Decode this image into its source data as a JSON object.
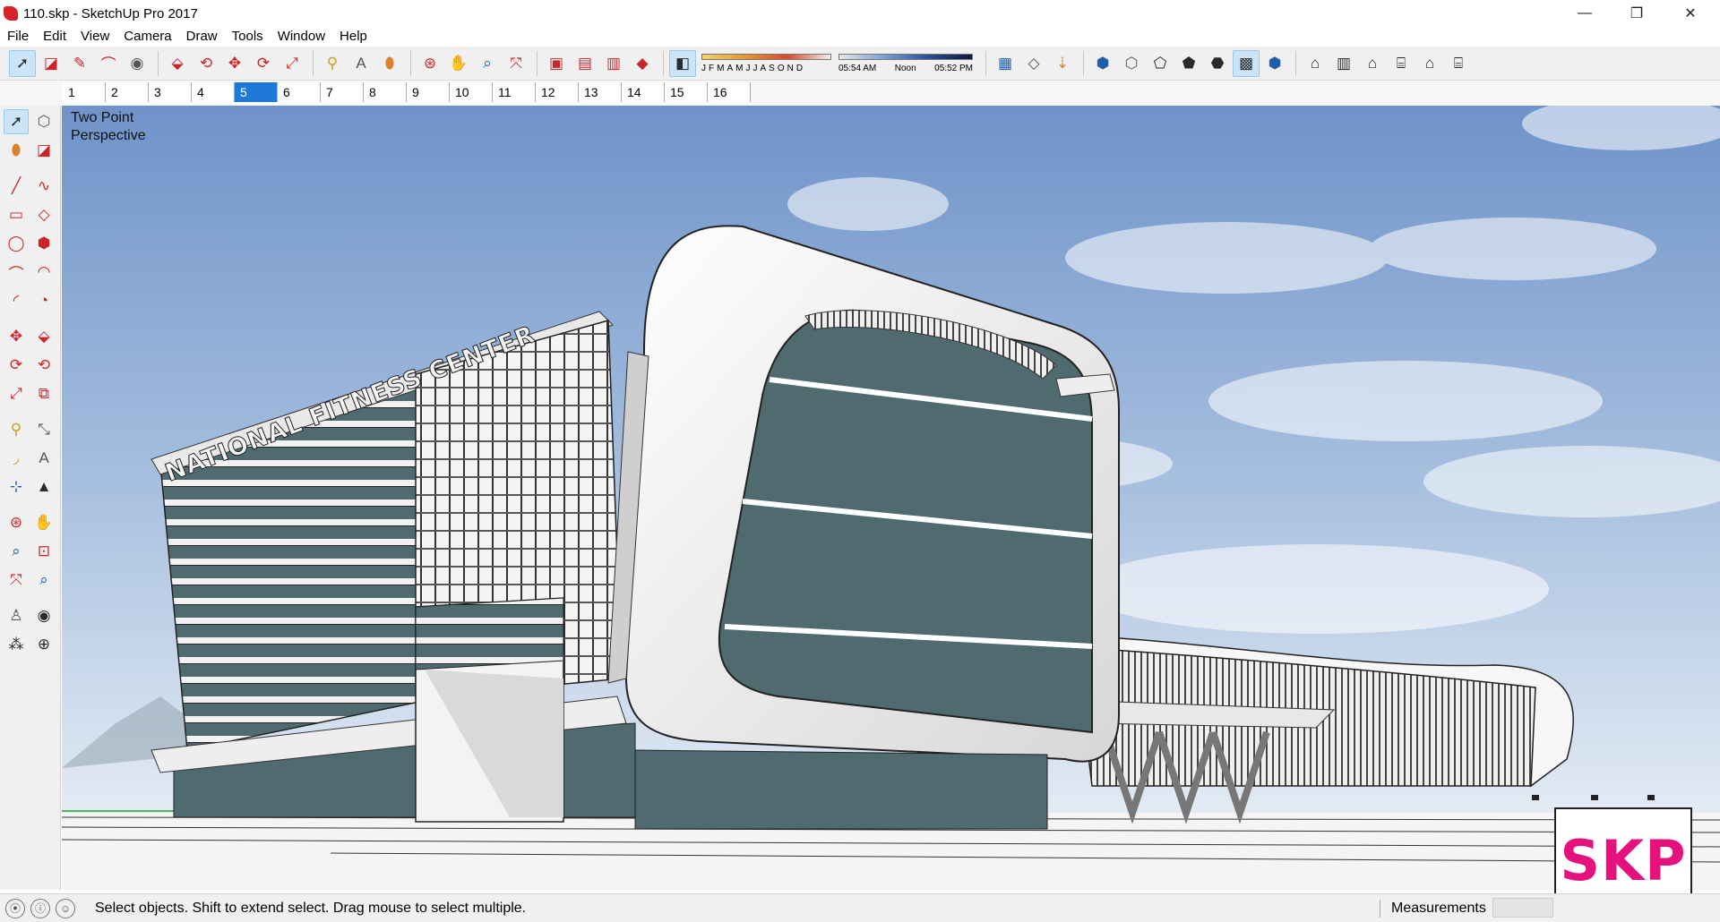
{
  "window": {
    "title": "110.skp - SketchUp Pro 2017",
    "minimize_glyph": "—",
    "maximize_glyph": "❐",
    "close_glyph": "✕"
  },
  "menu": [
    "File",
    "Edit",
    "View",
    "Camera",
    "Draw",
    "Tools",
    "Window",
    "Help"
  ],
  "shadow_settings": {
    "months": [
      "J",
      "F",
      "M",
      "A",
      "M",
      "J",
      "J",
      "A",
      "S",
      "O",
      "N",
      "D"
    ],
    "time_start": "05:54 AM",
    "time_mid": "Noon",
    "time_end": "05:52 PM"
  },
  "scene_tabs": [
    "1",
    "2",
    "3",
    "4",
    "5",
    "6",
    "7",
    "8",
    "9",
    "10",
    "11",
    "12",
    "13",
    "14",
    "15",
    "16"
  ],
  "active_scene": "5",
  "viewport": {
    "camera_label": "Two Point\nPerspective",
    "building_sign": "NATIONAL FITNESS CENTER",
    "colors": {
      "sky_top": "#6f93c9",
      "sky_bottom": "#dfe8f2",
      "glass": "#4f6b70",
      "accent_tab": "#1e7ad6"
    }
  },
  "watermark": "SKP",
  "status": {
    "message": "Select objects. Shift to extend select. Drag mouse to select multiple.",
    "measurements_label": "Measurements",
    "measurements_value": ""
  }
}
